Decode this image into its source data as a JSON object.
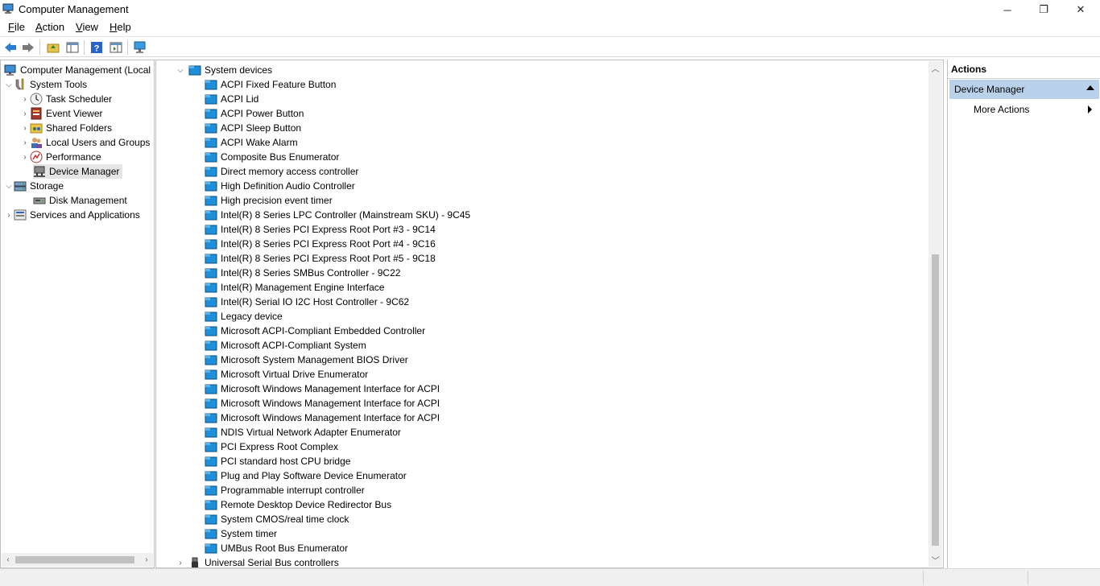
{
  "window": {
    "title": "Computer Management",
    "controls": {
      "minimize": "─",
      "maximize": "❐",
      "close": "✕"
    }
  },
  "menu": [
    {
      "label": "File",
      "accel": "F",
      "rest": "ile"
    },
    {
      "label": "Action",
      "accel": "A",
      "rest": "ction"
    },
    {
      "label": "View",
      "accel": "V",
      "rest": "iew"
    },
    {
      "label": "Help",
      "accel": "H",
      "rest": "elp"
    }
  ],
  "tree": {
    "root": "Computer Management (Local",
    "system_tools": "System Tools",
    "task_scheduler": "Task Scheduler",
    "event_viewer": "Event Viewer",
    "shared_folders": "Shared Folders",
    "local_users": "Local Users and Groups",
    "performance": "Performance",
    "device_manager": "Device Manager",
    "storage": "Storage",
    "disk_management": "Disk Management",
    "services": "Services and Applications"
  },
  "devices": {
    "category": "System devices",
    "items": [
      "ACPI Fixed Feature Button",
      "ACPI Lid",
      "ACPI Power Button",
      "ACPI Sleep Button",
      "ACPI Wake Alarm",
      "Composite Bus Enumerator",
      "Direct memory access controller",
      "High Definition Audio Controller",
      "High precision event timer",
      "Intel(R) 8 Series LPC Controller (Mainstream SKU) - 9C45",
      "Intel(R) 8 Series PCI Express Root Port #3 - 9C14",
      "Intel(R) 8 Series PCI Express Root Port #4 - 9C16",
      "Intel(R) 8 Series PCI Express Root Port #5 - 9C18",
      "Intel(R) 8 Series SMBus Controller - 9C22",
      "Intel(R) Management Engine Interface",
      "Intel(R) Serial IO I2C Host Controller - 9C62",
      "Legacy device",
      "Microsoft ACPI-Compliant Embedded Controller",
      "Microsoft ACPI-Compliant System",
      "Microsoft System Management BIOS Driver",
      "Microsoft Virtual Drive Enumerator",
      "Microsoft Windows Management Interface for ACPI",
      "Microsoft Windows Management Interface for ACPI",
      "Microsoft Windows Management Interface for ACPI",
      "NDIS Virtual Network Adapter Enumerator",
      "PCI Express Root Complex",
      "PCI standard host CPU bridge",
      "Plug and Play Software Device Enumerator",
      "Programmable interrupt controller",
      "Remote Desktop Device Redirector Bus",
      "System CMOS/real time clock",
      "System timer",
      "UMBus Root Bus Enumerator"
    ],
    "next_category": "Universal Serial Bus controllers"
  },
  "actions": {
    "title": "Actions",
    "section": "Device Manager",
    "more": "More Actions"
  },
  "icons": {
    "device": "device-icon",
    "folder": "system-devices-folder-icon"
  },
  "colors": {
    "selection": "#e5e5e5",
    "actions_header": "#b9d1ea",
    "device_icon": "#1e8fd8"
  }
}
